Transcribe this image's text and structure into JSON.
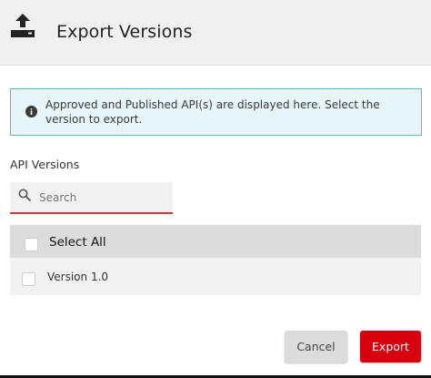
{
  "dialog": {
    "title": "Export Versions",
    "title_icon": "upload-tray-icon"
  },
  "info": {
    "icon": "info-circle-icon",
    "message": "Approved and Published API(s) are displayed here. Select the version to export."
  },
  "versions": {
    "section_label": "API Versions",
    "search": {
      "placeholder": "Search",
      "value": "",
      "icon": "search-icon"
    },
    "select_all_label": "Select All",
    "select_all_checked": false,
    "items": [
      {
        "label": "Version 1.0",
        "checked": false
      }
    ]
  },
  "actions": {
    "cancel_label": "Cancel",
    "export_label": "Export"
  },
  "colors": {
    "accent": "#d6000f",
    "info_border": "#5fb6ce",
    "info_background": "#e8f5f8",
    "header_background": "#f0f0f0"
  }
}
